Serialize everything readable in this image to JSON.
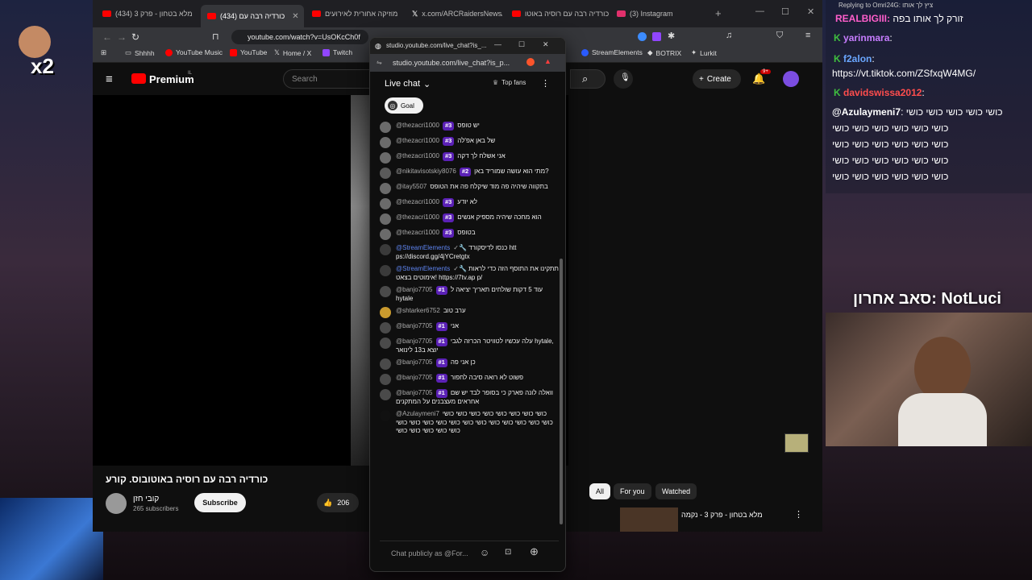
{
  "browser": {
    "tabs": [
      {
        "label": "(434) מלא בטחון - פרק 3"
      },
      {
        "label": "(434) כורדיה רבה עם"
      },
      {
        "label": "מוזיקה אחורית לאירועים"
      },
      {
        "label": "x.com/ARCRaidersNews/st"
      },
      {
        "label": "כורדיה רבה עם רוסיה באוטו"
      },
      {
        "label": "(3) Instagram"
      }
    ],
    "address": "youtube.com/watch?v=UsOKcCh0f",
    "bookmarks": [
      "Shhhh",
      "YouTube Music",
      "YouTube",
      "Home / X",
      "Twitch",
      "StreamElements",
      "BOTRIX",
      "Lurkit"
    ]
  },
  "youtube": {
    "logo_text": "Premium",
    "region": "IL",
    "search_placeholder": "Search",
    "create_label": "Create",
    "notif_count": "9+",
    "video_title": "כורדיה רבה עם רוסיה באוטובוס. קורע",
    "channel_name": "קובי חזן",
    "subscribers": "265 subscribers",
    "subscribe_label": "Subscribe",
    "likes": "206",
    "filters": [
      "All",
      "For you",
      "Watched"
    ],
    "next_video": "מלא בטחון - פרק 3 - נקמה"
  },
  "popup": {
    "window_title": "studio.youtube.com/live_chat?is_...",
    "url": "studio.youtube.com/live_chat?is_p...",
    "header": "Live chat",
    "top_fans": "Top fans",
    "goal": "Goal",
    "input_placeholder": "Chat publicly as @For...",
    "messages": [
      {
        "author": "@thezacri1000",
        "badge": "#3",
        "text": "יש טופס",
        "mod": false,
        "color": "#6b6b6b"
      },
      {
        "author": "@thezacri1000",
        "badge": "#3",
        "text": "של באן אפ'לה",
        "mod": false,
        "color": "#6b6b6b"
      },
      {
        "author": "@thezacri1000",
        "badge": "#3",
        "text": "אני אשלח לך דקה",
        "mod": false,
        "color": "#6b6b6b"
      },
      {
        "author": "@nikitavisotskiy8076",
        "badge": "#2",
        "text": "מתי הוא עושה שמוריד באן?",
        "mod": false,
        "color": "#5a5a5a"
      },
      {
        "author": "@itay5507",
        "badge": "",
        "text": "בתקווה שיהיה פה מוד שיקלח פה את הטופס",
        "mod": false,
        "color": "#6b6b6b"
      },
      {
        "author": "@thezacri1000",
        "badge": "#3",
        "text": "לא יודע",
        "mod": false,
        "color": "#6b6b6b"
      },
      {
        "author": "@thezacri1000",
        "badge": "#3",
        "text": "הוא מחכה שיהיה מספיק אנשים",
        "mod": false,
        "color": "#6b6b6b"
      },
      {
        "author": "@thezacri1000",
        "badge": "#3",
        "text": "בטופס",
        "mod": false,
        "color": "#6b6b6b"
      },
      {
        "author": "@StreamElements",
        "badge": "",
        "text": "כנסו לדיסקורד htt ps://discord.gg/4jYCretgtx",
        "mod": true,
        "color": "#3a3a3a"
      },
      {
        "author": "@StreamElements",
        "badge": "",
        "text": "תתקינו את התוסף הזה כדי לראות אימוטים בצאט! https://7tv.ap p/",
        "mod": true,
        "color": "#3a3a3a"
      },
      {
        "author": "@banjo7705",
        "badge": "#1",
        "text": "עוד 5 דקות שולחים תאריך יציאה ל hytale",
        "mod": false,
        "color": "#4a4a4a"
      },
      {
        "author": "@shtarker6752",
        "badge": "",
        "text": "ערב טוב",
        "mod": false,
        "color": "#c99a2e"
      },
      {
        "author": "@banjo7705",
        "badge": "#1",
        "text": "אני",
        "mod": false,
        "color": "#4a4a4a"
      },
      {
        "author": "@banjo7705",
        "badge": "#1",
        "text": "עלה עכשיו לטוויטר הכרזה לגבי hytale, יוצא ב13 לינואר",
        "mod": false,
        "color": "#4a4a4a"
      },
      {
        "author": "@banjo7705",
        "badge": "#1",
        "text": "כן אני פה",
        "mod": false,
        "color": "#4a4a4a"
      },
      {
        "author": "@banjo7705",
        "badge": "#1",
        "text": "פשוט לא רואה סיבה לחפור",
        "mod": false,
        "color": "#4a4a4a"
      },
      {
        "author": "@banjo7705",
        "badge": "#1",
        "text": "וואלה לונה פארק כי בסופר לבד יש שם אחראים מעצבנים על המתקנים",
        "mod": false,
        "color": "#4a4a4a"
      },
      {
        "author": "@Azulaymeni7",
        "badge": "",
        "text": "כושי כושי כושי כושי כושי כושי כושי כושי כושי כושי כושי כושי כושי כושי כושי כושי כושי כושי כושי כושי כושי כושי כושי כושי כושי",
        "mod": false,
        "color": "#111111"
      }
    ]
  },
  "stream_chat": {
    "replying": "Replying to Omri24G: ציץ לך אותו",
    "lines": [
      {
        "user": "REALBIGIII:",
        "text": "זורק לך אותו בפה",
        "color": "#ff5ecb"
      },
      {
        "user": "yarinmara",
        "text": ":",
        "color": "#c77dff"
      },
      {
        "user": "f2alon",
        "text": ":",
        "color": "#6aa7ff"
      },
      {
        "user": "",
        "text": "https://vt.tiktok.com/ZSfxqW4MG/",
        "color": "#ffffff"
      },
      {
        "user": "davidswissa2012",
        "text": ":",
        "color": "#ff4d4d"
      },
      {
        "user": "@Azulaymeni7",
        "text": ": כושי כושי כושי כושי כושי",
        "color": "#ffffff"
      }
    ],
    "spam": "כושי כושי כושי כושי כושי כושי",
    "last_sub": "סאב אחרון: NotLuci"
  },
  "overlay": {
    "multiplier": "x2"
  }
}
